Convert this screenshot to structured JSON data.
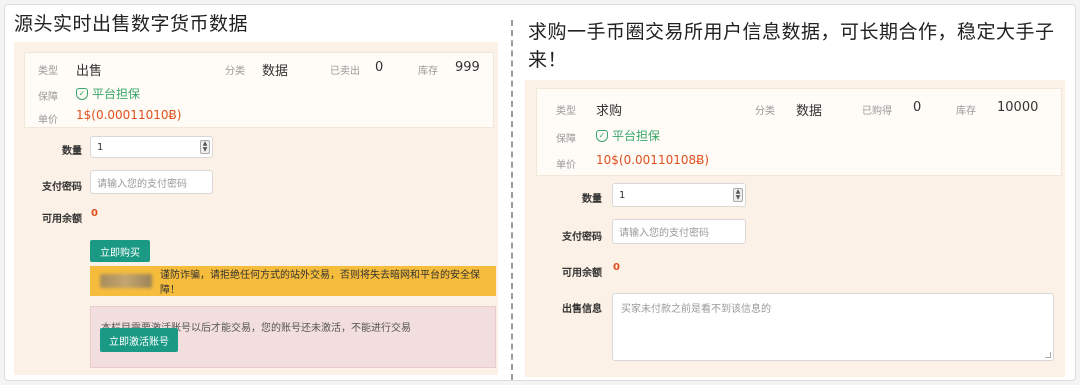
{
  "left": {
    "heading": "源头实时出售数字货币数据",
    "info": {
      "type_label": "类型",
      "type_value": "出售",
      "cat_label": "分类",
      "cat_value": "数据",
      "count_label": "已卖出",
      "count_value": "0",
      "stock_label": "库存",
      "stock_value": "999",
      "guarantee_label": "保障",
      "guarantee_value": "平台担保",
      "price_label": "单价",
      "price_value": "1$(0.00011010Ƀ)"
    },
    "form": {
      "qty_label": "数量",
      "qty_value": "1",
      "pwd_label": "支付密码",
      "pwd_placeholder": "请输入您的支付密码",
      "balance_label": "可用余额",
      "balance_value": "0"
    },
    "buy_button": "立即购买",
    "warning": "谨防诈骗，请拒绝任何方式的站外交易，否则将失去暗网和平台的安全保障！",
    "alert_text": "本栏目需要激活账号以后才能交易，您的账号还未激活，不能进行交易",
    "activate_button": "立即激活账号"
  },
  "right": {
    "heading_line1": "求购一手币圈交易所用户信息数据，可长期合作，稳定大手子",
    "heading_line2": "来！",
    "info": {
      "type_label": "类型",
      "type_value": "求购",
      "cat_label": "分类",
      "cat_value": "数据",
      "count_label": "已购得",
      "count_value": "0",
      "stock_label": "库存",
      "stock_value": "10000",
      "guarantee_label": "保障",
      "guarantee_value": "平台担保",
      "price_label": "单价",
      "price_value": "10$(0.00110108Ƀ)"
    },
    "form": {
      "qty_label": "数量",
      "qty_value": "1",
      "pwd_label": "支付密码",
      "pwd_placeholder": "请输入您的支付密码",
      "balance_label": "可用余额",
      "balance_value": "0",
      "sell_label": "出售信息",
      "sell_placeholder": "买家未付款之前是看不到该信息的"
    }
  },
  "colors": {
    "accent": "#1a9a84",
    "price": "#e0501e",
    "guarantee": "#3aa66b",
    "warning_bg": "#f6bc3b",
    "panel_bg": "#fcf1e6"
  }
}
